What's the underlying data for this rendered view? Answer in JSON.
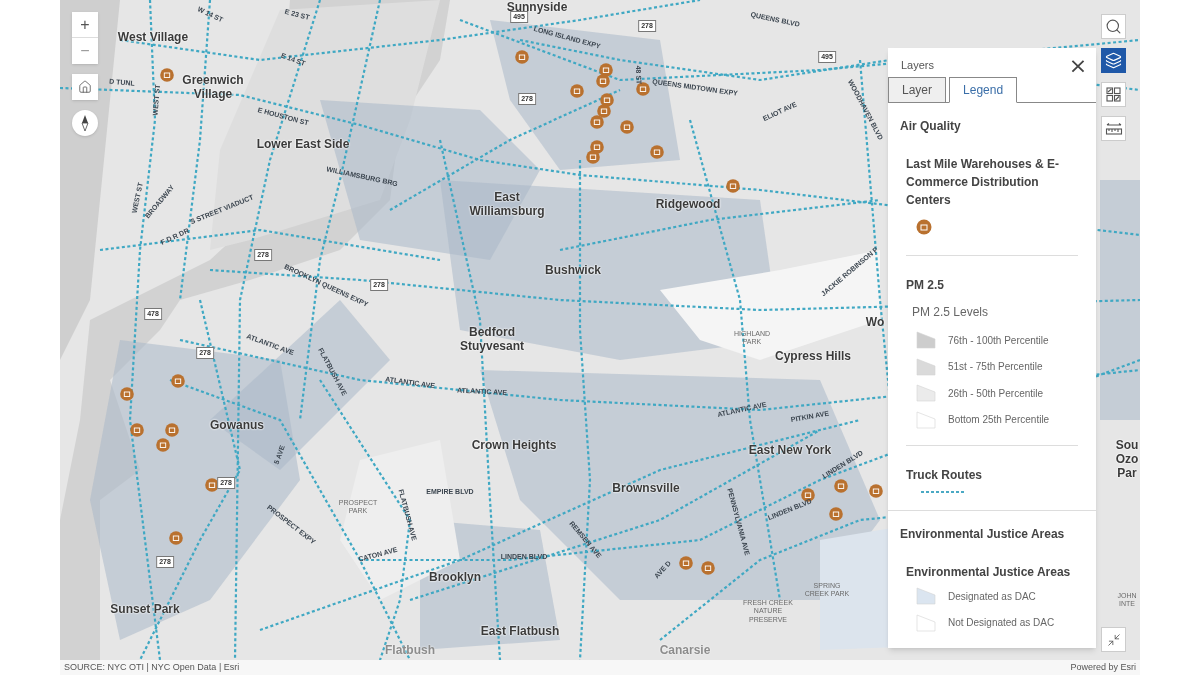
{
  "map_controls": {
    "zoom_in": "+",
    "zoom_out": "−"
  },
  "toolbar": [
    {
      "kind": "search",
      "selected": false
    },
    {
      "kind": "layers",
      "selected": true
    },
    {
      "kind": "basemap",
      "selected": false
    },
    {
      "kind": "measure",
      "selected": false
    }
  ],
  "layers_panel": {
    "title": "Layers",
    "close": "×",
    "tabs": [
      {
        "label": "Layer",
        "selected": false
      },
      {
        "label": "Legend",
        "selected": true
      }
    ],
    "groups": [
      {
        "title": "Air Quality",
        "layers": [
          {
            "title": "Last Mile Warehouses & E-Commerce Distribution Centers",
            "items": [
              {
                "kind": "marker"
              }
            ]
          },
          {
            "title": "PM 2.5",
            "subtitle": "PM 2.5 Levels",
            "items": [
              {
                "kind": "swatch",
                "color": "#cdcdcd",
                "label": "76th - 100th Percentile"
              },
              {
                "kind": "swatch",
                "color": "#dadada",
                "label": "51st - 75th Percentile"
              },
              {
                "kind": "swatch",
                "color": "#ebebeb",
                "label": "26th - 50th Percentile"
              },
              {
                "kind": "swatch",
                "color": "#ffffff",
                "label": "Bottom 25th Percentile"
              }
            ]
          },
          {
            "title": "Truck Routes",
            "items": [
              {
                "kind": "dashed-line",
                "color": "#4aa9c4"
              }
            ]
          }
        ]
      },
      {
        "title": "Environmental Justice Areas",
        "layers": [
          {
            "title": "Environmental Justice Areas",
            "items": [
              {
                "kind": "swatch",
                "color": "#dbe5f0",
                "label": "Designated as DAC"
              },
              {
                "kind": "swatch",
                "color": "#ffffff",
                "label": "Not Designated as DAC"
              }
            ]
          }
        ]
      }
    ]
  },
  "map_labels": [
    {
      "text": "Sunnyside",
      "kind": "place"
    },
    {
      "text": "West Village",
      "kind": "place"
    },
    {
      "text": "Greenwich Village",
      "kind": "place"
    },
    {
      "text": "Lower East Side",
      "kind": "place"
    },
    {
      "text": "East Williamsburg",
      "kind": "place"
    },
    {
      "text": "Ridgewood",
      "kind": "place"
    },
    {
      "text": "Bushwick",
      "kind": "place"
    },
    {
      "text": "Bedford Stuyvesant",
      "kind": "place"
    },
    {
      "text": "Cypress Hills",
      "kind": "place"
    },
    {
      "text": "Gowanus",
      "kind": "place"
    },
    {
      "text": "Crown Heights",
      "kind": "place"
    },
    {
      "text": "East New York",
      "kind": "place"
    },
    {
      "text": "Brownsville",
      "kind": "place"
    },
    {
      "text": "Brooklyn",
      "kind": "place"
    },
    {
      "text": "Sunset Park",
      "kind": "place"
    },
    {
      "text": "East Flatbush",
      "kind": "place"
    },
    {
      "text": "Wo",
      "kind": "place"
    },
    {
      "text": "Sou Ozo Par",
      "kind": "place"
    },
    {
      "text": "Flatbush",
      "kind": "faded"
    },
    {
      "text": "Canarsie",
      "kind": "faded"
    },
    {
      "text": "HIGHLAND PARK",
      "kind": "park"
    },
    {
      "text": "PROSPECT PARK",
      "kind": "park"
    },
    {
      "text": "SPRING CREEK PARK",
      "kind": "park"
    },
    {
      "text": "FRESH CREEK NATURE PRESERVE",
      "kind": "park"
    },
    {
      "text": "JOHN INTE",
      "kind": "park"
    },
    {
      "text": "QUEENS BLVD",
      "kind": "road"
    },
    {
      "text": "LONG ISLAND EXPY",
      "kind": "road"
    },
    {
      "text": "QUEENS MIDTOWN EXPY",
      "kind": "road"
    },
    {
      "text": "ELIOT AVE",
      "kind": "road"
    },
    {
      "text": "WOODHAVEN BLVD",
      "kind": "road"
    },
    {
      "text": "JACKIE ROBINSON P",
      "kind": "road"
    },
    {
      "text": "48 ST",
      "kind": "road"
    },
    {
      "text": "W 14 ST",
      "kind": "road"
    },
    {
      "text": "E 23 ST",
      "kind": "road"
    },
    {
      "text": "E 14 ST",
      "kind": "road"
    },
    {
      "text": "E HOUSTON ST",
      "kind": "road"
    },
    {
      "text": "WILLIAMSBURG BRG",
      "kind": "road"
    },
    {
      "text": "WEST ST",
      "kind": "road"
    },
    {
      "text": "WEST ST",
      "kind": "road"
    },
    {
      "text": "BROADWAY",
      "kind": "road"
    },
    {
      "text": "D TUNL",
      "kind": "road"
    },
    {
      "text": "F D R DR",
      "kind": "road"
    },
    {
      "text": "S STREET VIADUCT",
      "kind": "road"
    },
    {
      "text": "BROOKLYN QUEENS EXPY",
      "kind": "road"
    },
    {
      "text": "ATLANTIC AVE",
      "kind": "road"
    },
    {
      "text": "ATLANTIC AVE",
      "kind": "road"
    },
    {
      "text": "ATLANTIC AVE",
      "kind": "road"
    },
    {
      "text": "ATLANTIC AVE",
      "kind": "road"
    },
    {
      "text": "FLATBUSH AVE",
      "kind": "road"
    },
    {
      "text": "FLATBUSH AVE",
      "kind": "road"
    },
    {
      "text": "5 AVE",
      "kind": "road"
    },
    {
      "text": "PROSPECT EXPY",
      "kind": "road"
    },
    {
      "text": "EMPIRE BLVD",
      "kind": "road"
    },
    {
      "text": "CATON AVE",
      "kind": "road"
    },
    {
      "text": "LINDEN BLVD",
      "kind": "road"
    },
    {
      "text": "LINDEN BLVD",
      "kind": "road"
    },
    {
      "text": "LINDEN BLVD",
      "kind": "road"
    },
    {
      "text": "PITKIN AVE",
      "kind": "road"
    },
    {
      "text": "PENNSYLVANIA AVE",
      "kind": "road"
    },
    {
      "text": "REMSEN AVE",
      "kind": "road"
    },
    {
      "text": "AVE D",
      "kind": "road"
    }
  ],
  "shields": [
    "495",
    "278",
    "495",
    "278",
    "278",
    "278",
    "478",
    "278",
    "278",
    "278"
  ],
  "attribution": {
    "source": "SOURCE: NYC OTI | NYC Open Data | Esri",
    "powered": "Powered by Esri"
  }
}
